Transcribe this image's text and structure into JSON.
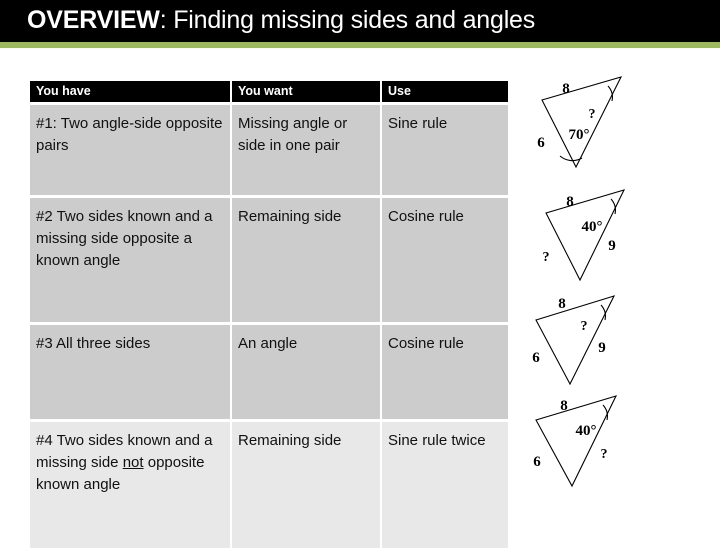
{
  "header": {
    "title_strong": "OVERVIEW",
    "title_rest": ": Finding missing sides and angles",
    "background_color": "#000000",
    "accent_color": "#9CBB5B",
    "text_color": "#FFFFFF"
  },
  "table": {
    "columns": [
      "You have",
      "You want",
      "Use"
    ],
    "row_background": "#CCCCCC",
    "last_row_background": "#E8E8E8",
    "rows": [
      {
        "you_have_prefix": "#1: Two angle-side opposite pairs",
        "you_want": "Missing angle or side in one pair",
        "use": "Sine rule"
      },
      {
        "you_have_prefix": "#2 Two sides known and a missing side opposite a known ",
        "you_have_suffix": "angle",
        "you_want": "Remaining side",
        "use": "Cosine rule"
      },
      {
        "you_have_prefix": "#3 All three sides",
        "you_want": "An angle",
        "use": "Cosine rule"
      },
      {
        "you_have_prefix": "#4 Two sides known and a missing side ",
        "you_have_emphasis": "not",
        "you_have_suffix": " opposite known angle",
        "you_want": "Remaining side",
        "use": "Sine rule twice"
      }
    ]
  },
  "figures": [
    {
      "name": "triangle-two-angle-side-pairs",
      "side_top": "8",
      "side_left": "6",
      "angle_known": "70°",
      "unknown": "?"
    },
    {
      "name": "triangle-two-sides-included-angle",
      "side_top": "8",
      "side_right": "9",
      "angle_known": "40°",
      "unknown": "?"
    },
    {
      "name": "triangle-three-sides",
      "side_top": "8",
      "side_left": "6",
      "side_right": "9",
      "unknown": "?"
    },
    {
      "name": "triangle-two-sides-not-opposite",
      "side_top": "8",
      "side_left": "6",
      "angle_known": "40°",
      "unknown": "?"
    }
  ]
}
